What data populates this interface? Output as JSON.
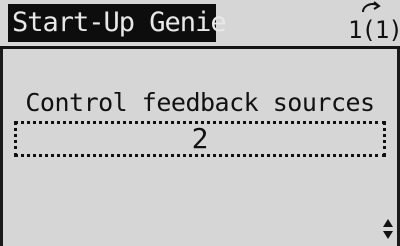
{
  "header": {
    "title": "Start-Up Genie",
    "status": "1(1)",
    "status_icon": "up-arrow-icon"
  },
  "parameter": {
    "label": "Control feedback sources",
    "value": "2"
  },
  "scroll_icon": "up-down-arrows-icon"
}
